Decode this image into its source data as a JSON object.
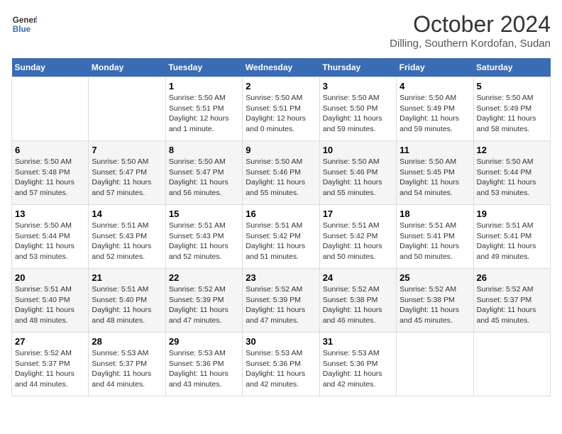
{
  "header": {
    "logo_line1": "General",
    "logo_line2": "Blue",
    "month": "October 2024",
    "location": "Dilling, Southern Kordofan, Sudan"
  },
  "days_of_week": [
    "Sunday",
    "Monday",
    "Tuesday",
    "Wednesday",
    "Thursday",
    "Friday",
    "Saturday"
  ],
  "weeks": [
    [
      {
        "day": "",
        "sunrise": "",
        "sunset": "",
        "daylight": ""
      },
      {
        "day": "",
        "sunrise": "",
        "sunset": "",
        "daylight": ""
      },
      {
        "day": "1",
        "sunrise": "Sunrise: 5:50 AM",
        "sunset": "Sunset: 5:51 PM",
        "daylight": "Daylight: 12 hours and 1 minute."
      },
      {
        "day": "2",
        "sunrise": "Sunrise: 5:50 AM",
        "sunset": "Sunset: 5:51 PM",
        "daylight": "Daylight: 12 hours and 0 minutes."
      },
      {
        "day": "3",
        "sunrise": "Sunrise: 5:50 AM",
        "sunset": "Sunset: 5:50 PM",
        "daylight": "Daylight: 11 hours and 59 minutes."
      },
      {
        "day": "4",
        "sunrise": "Sunrise: 5:50 AM",
        "sunset": "Sunset: 5:49 PM",
        "daylight": "Daylight: 11 hours and 59 minutes."
      },
      {
        "day": "5",
        "sunrise": "Sunrise: 5:50 AM",
        "sunset": "Sunset: 5:49 PM",
        "daylight": "Daylight: 11 hours and 58 minutes."
      }
    ],
    [
      {
        "day": "6",
        "sunrise": "Sunrise: 5:50 AM",
        "sunset": "Sunset: 5:48 PM",
        "daylight": "Daylight: 11 hours and 57 minutes."
      },
      {
        "day": "7",
        "sunrise": "Sunrise: 5:50 AM",
        "sunset": "Sunset: 5:47 PM",
        "daylight": "Daylight: 11 hours and 57 minutes."
      },
      {
        "day": "8",
        "sunrise": "Sunrise: 5:50 AM",
        "sunset": "Sunset: 5:47 PM",
        "daylight": "Daylight: 11 hours and 56 minutes."
      },
      {
        "day": "9",
        "sunrise": "Sunrise: 5:50 AM",
        "sunset": "Sunset: 5:46 PM",
        "daylight": "Daylight: 11 hours and 55 minutes."
      },
      {
        "day": "10",
        "sunrise": "Sunrise: 5:50 AM",
        "sunset": "Sunset: 5:46 PM",
        "daylight": "Daylight: 11 hours and 55 minutes."
      },
      {
        "day": "11",
        "sunrise": "Sunrise: 5:50 AM",
        "sunset": "Sunset: 5:45 PM",
        "daylight": "Daylight: 11 hours and 54 minutes."
      },
      {
        "day": "12",
        "sunrise": "Sunrise: 5:50 AM",
        "sunset": "Sunset: 5:44 PM",
        "daylight": "Daylight: 11 hours and 53 minutes."
      }
    ],
    [
      {
        "day": "13",
        "sunrise": "Sunrise: 5:50 AM",
        "sunset": "Sunset: 5:44 PM",
        "daylight": "Daylight: 11 hours and 53 minutes."
      },
      {
        "day": "14",
        "sunrise": "Sunrise: 5:51 AM",
        "sunset": "Sunset: 5:43 PM",
        "daylight": "Daylight: 11 hours and 52 minutes."
      },
      {
        "day": "15",
        "sunrise": "Sunrise: 5:51 AM",
        "sunset": "Sunset: 5:43 PM",
        "daylight": "Daylight: 11 hours and 52 minutes."
      },
      {
        "day": "16",
        "sunrise": "Sunrise: 5:51 AM",
        "sunset": "Sunset: 5:42 PM",
        "daylight": "Daylight: 11 hours and 51 minutes."
      },
      {
        "day": "17",
        "sunrise": "Sunrise: 5:51 AM",
        "sunset": "Sunset: 5:42 PM",
        "daylight": "Daylight: 11 hours and 50 minutes."
      },
      {
        "day": "18",
        "sunrise": "Sunrise: 5:51 AM",
        "sunset": "Sunset: 5:41 PM",
        "daylight": "Daylight: 11 hours and 50 minutes."
      },
      {
        "day": "19",
        "sunrise": "Sunrise: 5:51 AM",
        "sunset": "Sunset: 5:41 PM",
        "daylight": "Daylight: 11 hours and 49 minutes."
      }
    ],
    [
      {
        "day": "20",
        "sunrise": "Sunrise: 5:51 AM",
        "sunset": "Sunset: 5:40 PM",
        "daylight": "Daylight: 11 hours and 48 minutes."
      },
      {
        "day": "21",
        "sunrise": "Sunrise: 5:51 AM",
        "sunset": "Sunset: 5:40 PM",
        "daylight": "Daylight: 11 hours and 48 minutes."
      },
      {
        "day": "22",
        "sunrise": "Sunrise: 5:52 AM",
        "sunset": "Sunset: 5:39 PM",
        "daylight": "Daylight: 11 hours and 47 minutes."
      },
      {
        "day": "23",
        "sunrise": "Sunrise: 5:52 AM",
        "sunset": "Sunset: 5:39 PM",
        "daylight": "Daylight: 11 hours and 47 minutes."
      },
      {
        "day": "24",
        "sunrise": "Sunrise: 5:52 AM",
        "sunset": "Sunset: 5:38 PM",
        "daylight": "Daylight: 11 hours and 46 minutes."
      },
      {
        "day": "25",
        "sunrise": "Sunrise: 5:52 AM",
        "sunset": "Sunset: 5:38 PM",
        "daylight": "Daylight: 11 hours and 45 minutes."
      },
      {
        "day": "26",
        "sunrise": "Sunrise: 5:52 AM",
        "sunset": "Sunset: 5:37 PM",
        "daylight": "Daylight: 11 hours and 45 minutes."
      }
    ],
    [
      {
        "day": "27",
        "sunrise": "Sunrise: 5:52 AM",
        "sunset": "Sunset: 5:37 PM",
        "daylight": "Daylight: 11 hours and 44 minutes."
      },
      {
        "day": "28",
        "sunrise": "Sunrise: 5:53 AM",
        "sunset": "Sunset: 5:37 PM",
        "daylight": "Daylight: 11 hours and 44 minutes."
      },
      {
        "day": "29",
        "sunrise": "Sunrise: 5:53 AM",
        "sunset": "Sunset: 5:36 PM",
        "daylight": "Daylight: 11 hours and 43 minutes."
      },
      {
        "day": "30",
        "sunrise": "Sunrise: 5:53 AM",
        "sunset": "Sunset: 5:36 PM",
        "daylight": "Daylight: 11 hours and 42 minutes."
      },
      {
        "day": "31",
        "sunrise": "Sunrise: 5:53 AM",
        "sunset": "Sunset: 5:36 PM",
        "daylight": "Daylight: 11 hours and 42 minutes."
      },
      {
        "day": "",
        "sunrise": "",
        "sunset": "",
        "daylight": ""
      },
      {
        "day": "",
        "sunrise": "",
        "sunset": "",
        "daylight": ""
      }
    ]
  ]
}
